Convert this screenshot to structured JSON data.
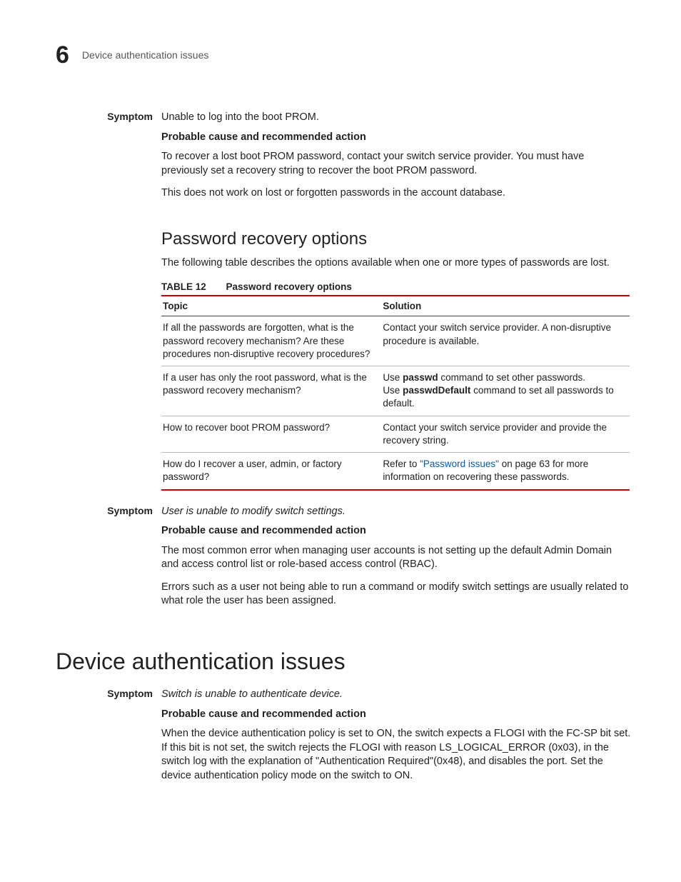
{
  "header": {
    "chapter_number": "6",
    "running_title": "Device authentication issues"
  },
  "symptom1": {
    "label": "Symptom",
    "text": "Unable to log into the boot PROM.",
    "cause_heading": "Probable cause and recommended action",
    "para1": "To recover a lost boot PROM password, contact your switch service provider. You must have previously set a recovery string to recover the boot PROM password.",
    "para2": "This does not work on lost or forgotten passwords in the account database."
  },
  "recovery_section": {
    "heading": "Password recovery options",
    "intro": "The following table describes the options available when one or more types of passwords are lost.",
    "table_label": "TABLE 12",
    "table_title": "Password recovery options",
    "columns": [
      "Topic",
      "Solution"
    ],
    "rows": [
      {
        "topic": "If all the passwords are forgotten, what is the password recovery mechanism? Are these procedures non-disruptive recovery procedures?",
        "solution": "Contact your switch service provider. A non-disruptive procedure is available."
      },
      {
        "topic": "If a user has only the root password, what is the password recovery mechanism?",
        "solution_pre": "Use ",
        "solution_cmd1": "passwd",
        "solution_mid1": " command to set other passwords.",
        "solution_br": true,
        "solution_pre2": "Use ",
        "solution_cmd2": "passwdDefault",
        "solution_mid2": " command to set all passwords to default."
      },
      {
        "topic": "How to recover boot PROM password?",
        "solution": "Contact your switch service provider and provide the recovery string."
      },
      {
        "topic": "How do I recover a user, admin, or factory password?",
        "solution_pre": "Refer to ",
        "solution_link": "\"Password issues\"",
        "solution_post": " on page 63 for more information on recovering these passwords."
      }
    ]
  },
  "symptom2": {
    "label": "Symptom",
    "text": "User is unable to modify switch settings.",
    "cause_heading": "Probable cause and recommended action",
    "para1": "The most common error when managing user accounts is not setting up the default Admin Domain and access control list or role-based access control (RBAC).",
    "para2": "Errors such as a user not being able to run a command or modify switch settings are usually related to what role the user has been assigned."
  },
  "device_auth_section": {
    "heading": "Device authentication issues"
  },
  "symptom3": {
    "label": "Symptom",
    "text": "Switch is unable to authenticate device.",
    "cause_heading": "Probable cause and recommended action",
    "para1": "When the device authentication policy is set to ON, the switch expects a FLOGI with the FC-SP bit set. If this bit is not set, the switch rejects the FLOGI with reason LS_LOGICAL_ERROR (0x03), in the switch log with the explanation of \"Authentication Required\"(0x48), and disables the port. Set the device authentication policy mode on the switch to ON."
  }
}
